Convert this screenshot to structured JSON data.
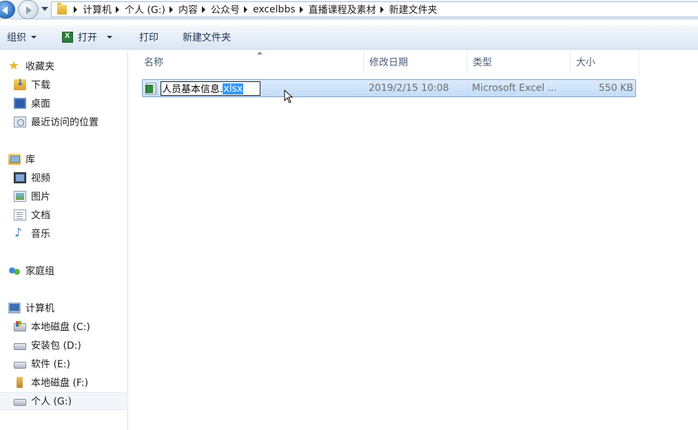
{
  "address_bar": {
    "breadcrumbs": [
      "计算机",
      "个人 (G:)",
      "内容",
      "公众号",
      "excelbbs",
      "直播课程及素材",
      "新建文件夹"
    ]
  },
  "toolbar": {
    "organize_label": "组织",
    "open_label": "打开",
    "print_label": "打印",
    "new_folder_label": "新建文件夹"
  },
  "navpane": {
    "favorites": {
      "label": "收藏夹",
      "items": [
        "下载",
        "桌面",
        "最近访问的位置"
      ]
    },
    "libraries": {
      "label": "库",
      "items": [
        "视频",
        "图片",
        "文档",
        "音乐"
      ]
    },
    "homegroup": {
      "label": "家庭组"
    },
    "computer": {
      "label": "计算机",
      "drives": [
        "本地磁盘 (C:)",
        "安装包 (D:)",
        "软件 (E:)",
        "本地磁盘 (F:)",
        "个人 (G:)"
      ]
    },
    "selected_drive": "个人 (G:)"
  },
  "columns": {
    "name": "名称",
    "modified": "修改日期",
    "type": "类型",
    "size": "大小"
  },
  "file": {
    "rename_base": "人员基本信息.",
    "rename_ext": "xlsx",
    "modified": "2019/2/15 10:08",
    "type": "Microsoft Excel ...",
    "size": "550 KB"
  },
  "icons": {
    "back": "back-arrow-icon",
    "forward": "forward-arrow-icon",
    "excel": "excel-icon",
    "folder": "folder-icon"
  }
}
